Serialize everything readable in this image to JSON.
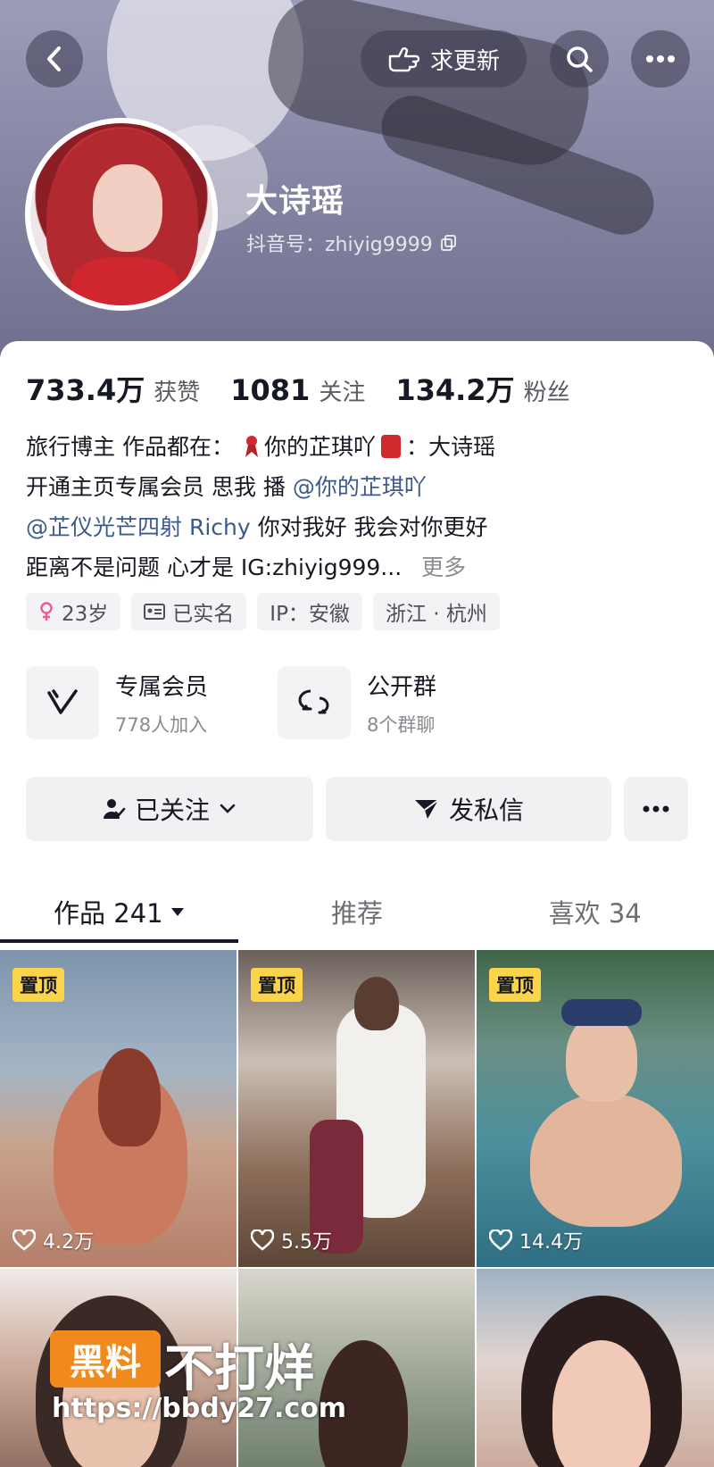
{
  "header": {
    "update_label": "求更新",
    "name": "大诗瑶",
    "douyin_id": "抖音号：zhiyig9999"
  },
  "stats": [
    {
      "num": "733.4万",
      "label": "获赞"
    },
    {
      "num": "1081",
      "label": "关注"
    },
    {
      "num": "134.2万",
      "label": "粉丝"
    }
  ],
  "bio": {
    "line1_a": "旅行博主 作品都在：",
    "line1_b": "你的芷琪吖",
    "line1_c": "：大诗瑶",
    "line2_a": "开通主页专属会员 思我 播",
    "line2_mention": "@你的芷琪吖",
    "line3_mention": "@芷仪光芒四射 Richy",
    "line3_b": " 你对我好 我会对你更好",
    "line4": "距离不是问题 心才是 IG:zhiyig999...",
    "more": "更多"
  },
  "tags": [
    {
      "label": "23岁"
    },
    {
      "label": "已实名"
    },
    {
      "label": "IP：安徽"
    },
    {
      "label": "浙江 · 杭州"
    }
  ],
  "features": [
    {
      "title": "专属会员",
      "sub": "778人加入"
    },
    {
      "title": "公开群",
      "sub": "8个群聊"
    }
  ],
  "actions": {
    "follow": "已关注",
    "message": "发私信"
  },
  "tabs": [
    {
      "label": "作品 241"
    },
    {
      "label": "推荐"
    },
    {
      "label": "喜欢 34"
    }
  ],
  "videos": [
    {
      "pin": "置顶",
      "likes": "4.2万"
    },
    {
      "pin": "置顶",
      "likes": "5.5万"
    },
    {
      "pin": "置顶",
      "likes": "14.4万"
    }
  ],
  "watermark": {
    "badge": "黑料",
    "text": "不打烊",
    "url": "https://bbdy27.com"
  },
  "colors": {
    "pin_badge": "#fbd44b",
    "mention": "#3a5a8c",
    "watermark_badge": "#f08a1c"
  }
}
